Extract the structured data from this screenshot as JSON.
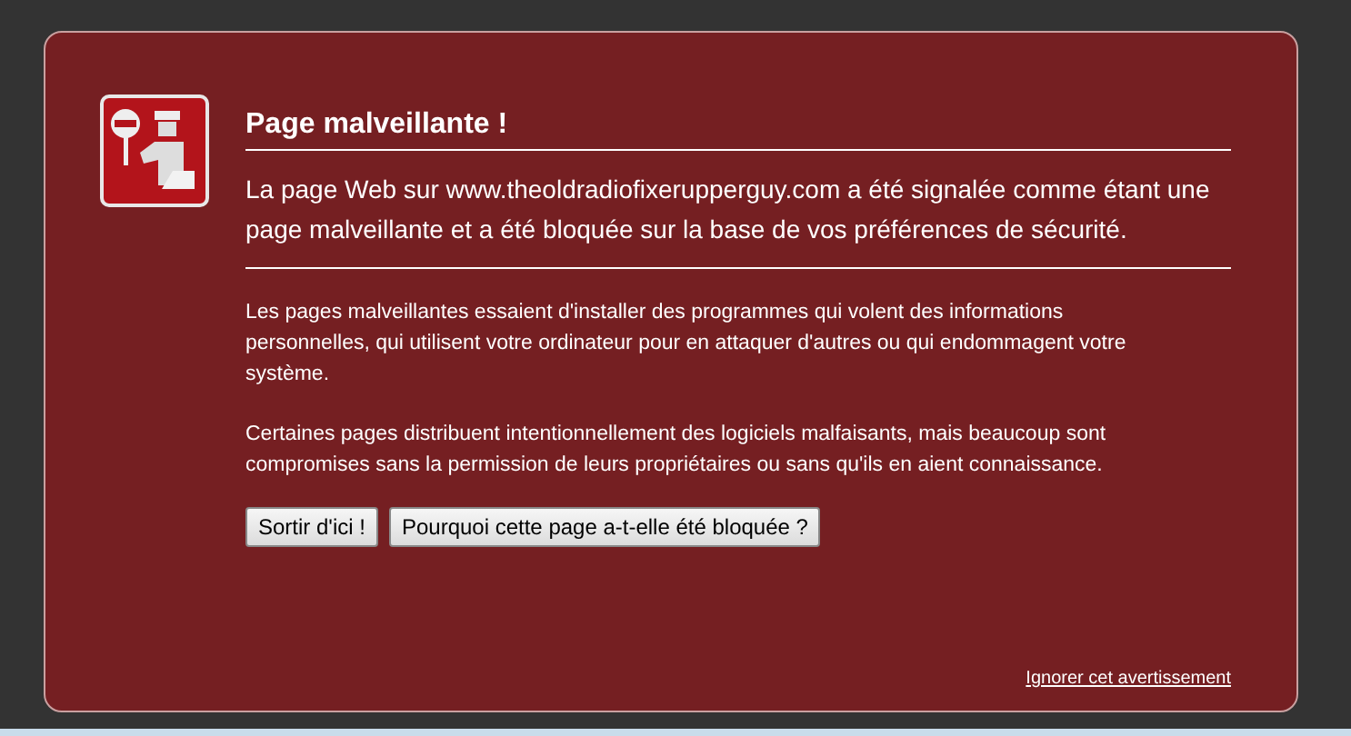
{
  "title": "Page malveillante !",
  "summary": "La page Web sur www.theoldradiofixerupperguy.com a été signalée comme étant une page malveillante et a été bloquée sur la base de vos préférences de sécurité.",
  "details": [
    "Les pages malveillantes essaient d'installer des programmes qui volent des informations personnelles, qui utilisent votre ordinateur pour en attaquer d'autres ou qui endommagent votre système.",
    "Certaines pages distribuent intentionnellement des logiciels malfaisants, mais beaucoup sont compromises sans la permission de leurs propriétaires ou sans qu'ils en aient connaissance."
  ],
  "buttons": [
    "Sortir d'ici !",
    "Pourquoi cette page a-t-elle été bloquée ?"
  ],
  "ignore_link": "Ignorer cet avertissement"
}
